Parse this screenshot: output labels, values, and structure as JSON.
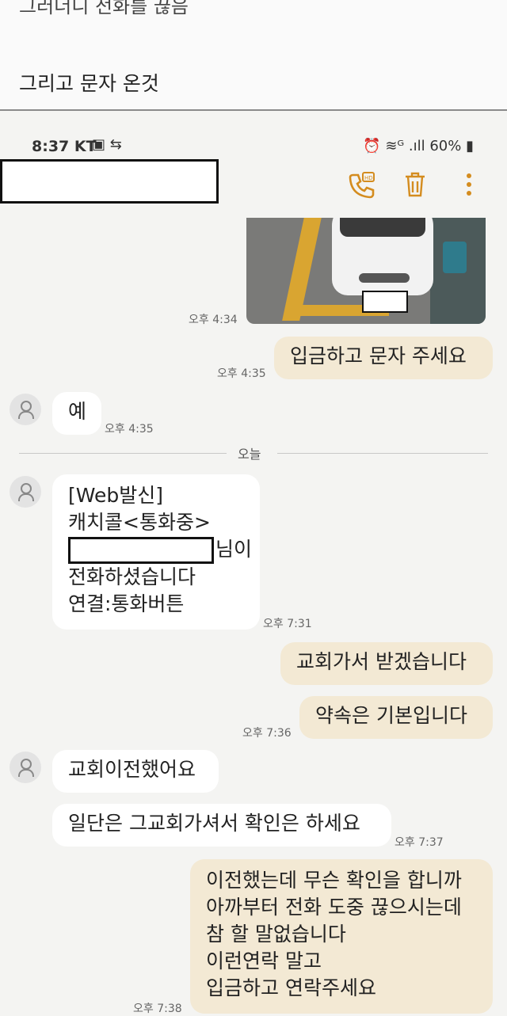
{
  "caption": {
    "cut_text": "그러더니 전화를 끊음",
    "main_text": "그리고 문자 온것"
  },
  "status_bar": {
    "time": "8:37",
    "carrier": "KT",
    "left_icons": "▣ ⇆",
    "right_text": "⏰ ≋ᴳ .ıll 60% ▮"
  },
  "app_bar": {
    "call_icon": "hd-call-icon",
    "delete_icon": "trash-icon",
    "menu_icon": "more-vert-icon",
    "accent": "#d48c1f"
  },
  "messages": {
    "m1_time": "오후 4:34",
    "m2_text": "입금하고 문자 주세요",
    "m2_time": "오후 4:35",
    "m3_text": "예",
    "m3_time": "오후 4:35",
    "divider": "오늘",
    "m4_line1": "[Web발신]",
    "m4_line2": "캐치콜<통화중>",
    "m4_line3_suffix": "님이",
    "m4_line4": "전화하셨습니다",
    "m4_line5": "연결:통화버튼",
    "m4_time": "오후 7:31",
    "m5_text": "교회가서 받겠습니다",
    "m6_text": "약속은 기본입니다",
    "m6_time": "오후 7:36",
    "m7_text": "교회이전했어요",
    "m8_text": "일단은 그교회가셔서 확인은 하세요",
    "m8_time": "오후 7:37",
    "m9_line1": "이전했는데 무슨 확인을 합니까",
    "m9_line2": "아까부터 전화 도중 끊으시는데",
    "m9_line3": "참 할 말없습니다",
    "m9_line4": "이런연락 말고",
    "m9_line5": "입금하고 연락주세요",
    "m9_time": "오후 7:38"
  }
}
